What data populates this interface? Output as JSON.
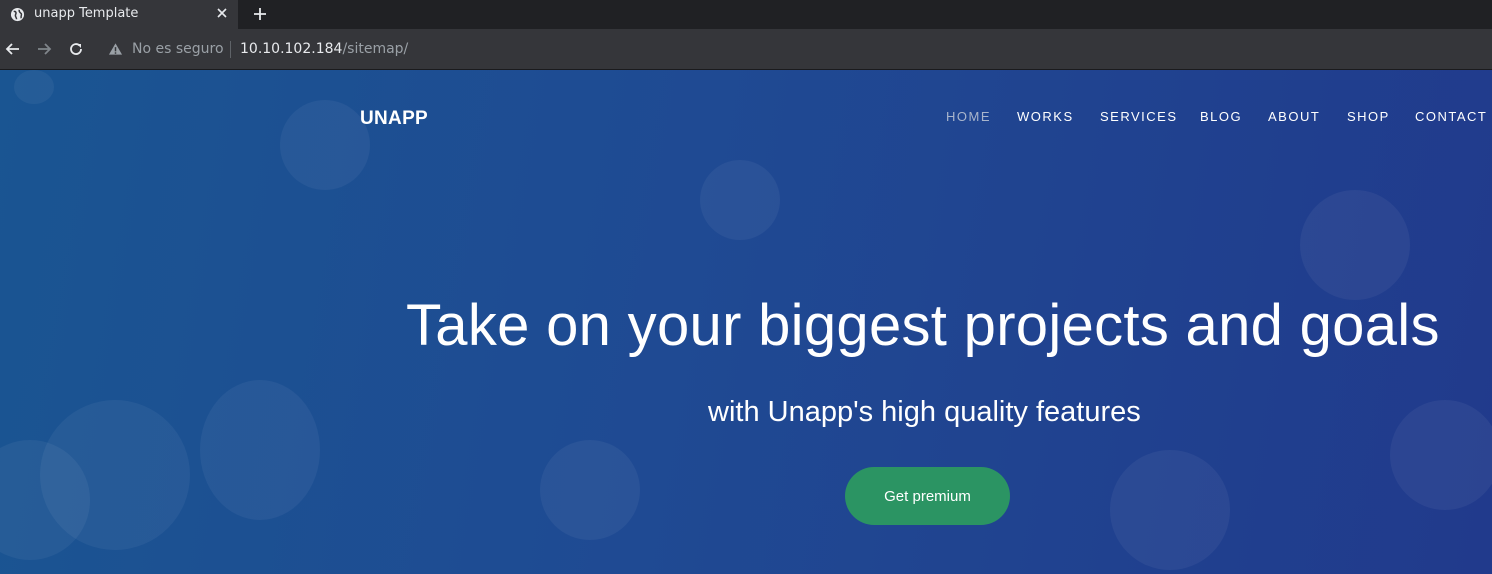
{
  "browser": {
    "tab": {
      "title": "unapp Template",
      "favicon": "globe-icon",
      "close_icon": "close-icon"
    },
    "new_tab_icon": "plus-icon",
    "toolbar": {
      "back_icon": "back-arrow-icon",
      "forward_icon": "forward-arrow-icon",
      "reload_icon": "reload-icon"
    },
    "omnibox": {
      "security_icon": "warning-triangle-icon",
      "security_text": "No es seguro",
      "url_host": "10.10.102.184",
      "url_path": "/sitemap/"
    }
  },
  "site": {
    "brand": "UNAPP",
    "nav": [
      {
        "label": "HOME",
        "active": true
      },
      {
        "label": "WORKS",
        "active": false
      },
      {
        "label": "SERVICES",
        "active": false
      },
      {
        "label": "BLOG",
        "active": false
      },
      {
        "label": "ABOUT",
        "active": false
      },
      {
        "label": "SHOP",
        "active": false
      },
      {
        "label": "CONTACT",
        "active": false
      }
    ],
    "hero": {
      "title": "Take on your biggest projects and goals",
      "subtitle": "with Unapp's high quality features",
      "cta_label": "Get premium"
    }
  },
  "colors": {
    "chrome_bg": "#202124",
    "toolbar_bg": "#35363a",
    "hero_gradient_start": "#1a5592",
    "hero_gradient_end": "#213a8c",
    "cta_bg": "#2b9463",
    "nav_active": "#a9b5cc"
  }
}
